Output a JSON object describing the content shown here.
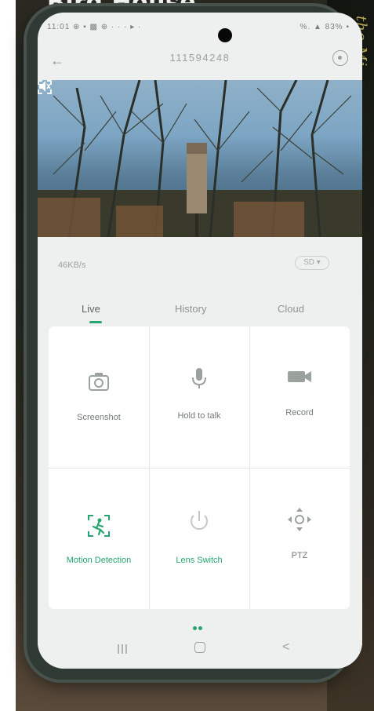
{
  "caption": "Bird House",
  "background_text": "the Mi",
  "status_bar": {
    "left": "11:01 ⊕ ▪ ▩ ⊕ · · · ▸ ·",
    "right": "%. ▲ 83% ▪"
  },
  "header": {
    "back_icon": "arrow-left-icon",
    "title": "111594248",
    "settings_icon": "settings-icon"
  },
  "video": {
    "mute_icon": "speaker-mute-icon",
    "fullscreen_icon": "fullscreen-icon"
  },
  "stream": {
    "speed": "46KB/s",
    "quality": "SD ▾"
  },
  "tabs": [
    {
      "label": "Live",
      "active": true
    },
    {
      "label": "History",
      "active": false
    },
    {
      "label": "Cloud",
      "active": false
    }
  ],
  "controls": [
    {
      "label": "Screenshot",
      "icon": "camera-icon",
      "active": false
    },
    {
      "label": "Hold to talk",
      "icon": "microphone-icon",
      "active": false
    },
    {
      "label": "Record",
      "icon": "video-camera-icon",
      "active": false
    },
    {
      "label": "Motion Detection",
      "icon": "motion-detection-icon",
      "active": true
    },
    {
      "label": "Lens Switch",
      "icon": "power-icon",
      "active": false
    },
    {
      "label": "PTZ",
      "icon": "ptz-arrows-icon",
      "active": false
    }
  ],
  "colors": {
    "accent": "#27a56f",
    "label": "#737a76",
    "icon": "#9ba19d"
  },
  "navbar": {
    "recents_icon": "recents-icon",
    "home_icon": "home-icon",
    "back_label": "<"
  }
}
